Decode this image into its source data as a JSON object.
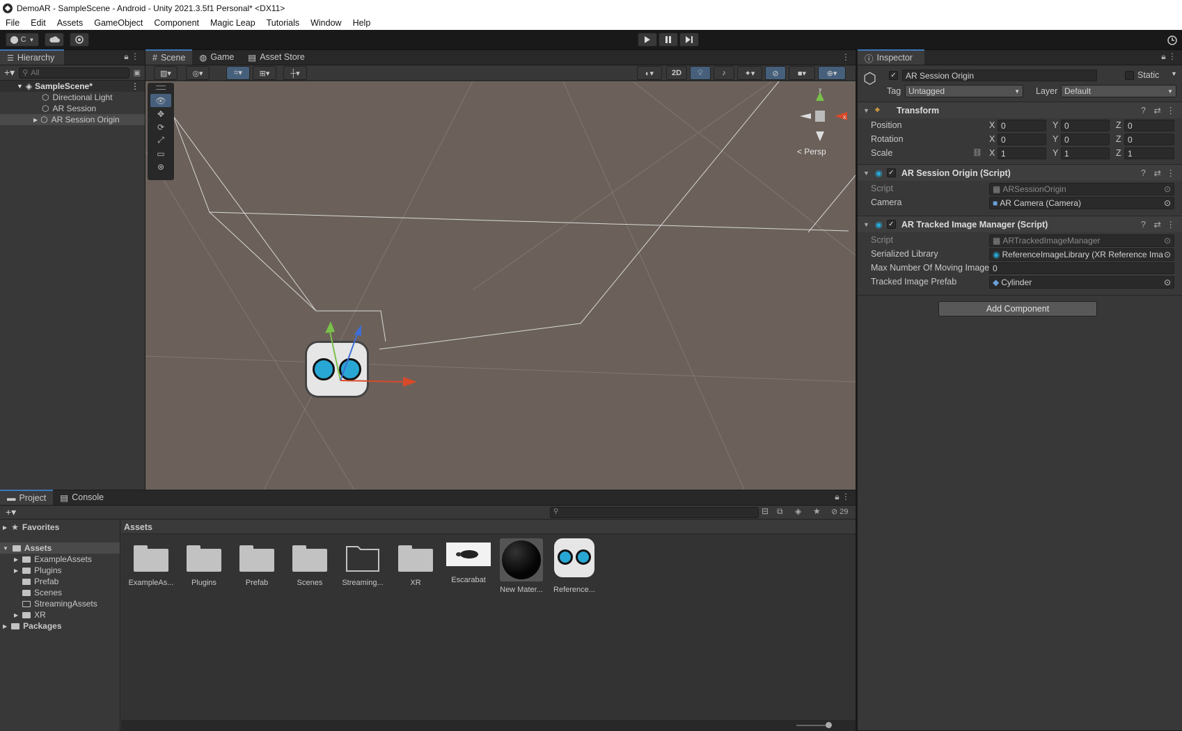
{
  "window": {
    "title": "DemoAR - SampleScene - Android - Unity 2021.3.5f1 Personal* <DX11>"
  },
  "menu": [
    "File",
    "Edit",
    "Assets",
    "GameObject",
    "Component",
    "Magic Leap",
    "Tutorials",
    "Window",
    "Help"
  ],
  "toolbar": {
    "account_label": "C"
  },
  "hierarchy": {
    "tab": "Hierarchy",
    "search_placeholder": "All",
    "scene": "SampleScene*",
    "items": [
      "Directional Light",
      "AR Session",
      "AR Session Origin"
    ]
  },
  "scene_view": {
    "tabs": [
      "Scene",
      "Game",
      "Asset Store"
    ],
    "mode_2d": "2D",
    "persp_label": "< Persp",
    "gizmo_axes": {
      "y": "y",
      "x": "x"
    }
  },
  "inspector": {
    "tab": "Inspector",
    "object_name": "AR Session Origin",
    "static_label": "Static",
    "tag_label": "Tag",
    "tag_value": "Untagged",
    "layer_label": "Layer",
    "layer_value": "Default",
    "transform": {
      "title": "Transform",
      "rows": [
        {
          "label": "Position",
          "x": "0",
          "y": "0",
          "z": "0"
        },
        {
          "label": "Rotation",
          "x": "0",
          "y": "0",
          "z": "0"
        },
        {
          "label": "Scale",
          "x": "1",
          "y": "1",
          "z": "1"
        }
      ],
      "axis_x": "X",
      "axis_y": "Y",
      "axis_z": "Z"
    },
    "session_origin": {
      "title": "AR Session Origin (Script)",
      "script_label": "Script",
      "script_value": "ARSessionOrigin",
      "camera_label": "Camera",
      "camera_value": "AR Camera (Camera)"
    },
    "tracked_image": {
      "title": "AR Tracked Image Manager (Script)",
      "script_label": "Script",
      "script_value": "ARTrackedImageManager",
      "library_label": "Serialized Library",
      "library_value": "ReferenceImageLibrary (XR Reference Ima",
      "max_label": "Max Number Of Moving Image",
      "max_value": "0",
      "prefab_label": "Tracked Image Prefab",
      "prefab_value": "Cylinder"
    },
    "add_component": "Add Component"
  },
  "project": {
    "tabs": [
      "Project",
      "Console"
    ],
    "favorites": "Favorites",
    "assets_root": "Assets",
    "tree": [
      "ExampleAssets",
      "Plugins",
      "Prefab",
      "Scenes",
      "StreamingAssets",
      "XR"
    ],
    "packages": "Packages",
    "breadcrumb": "Assets",
    "hidden_count": "29",
    "grid": [
      "ExampleAs...",
      "Plugins",
      "Prefab",
      "Scenes",
      "Streaming...",
      "XR",
      "Escarabat",
      "New Mater...",
      "Reference..."
    ]
  },
  "colors": {
    "accent": "#3a79bb",
    "scene_bg": "#6b615a",
    "panel": "#383838",
    "dark": "#282828"
  }
}
